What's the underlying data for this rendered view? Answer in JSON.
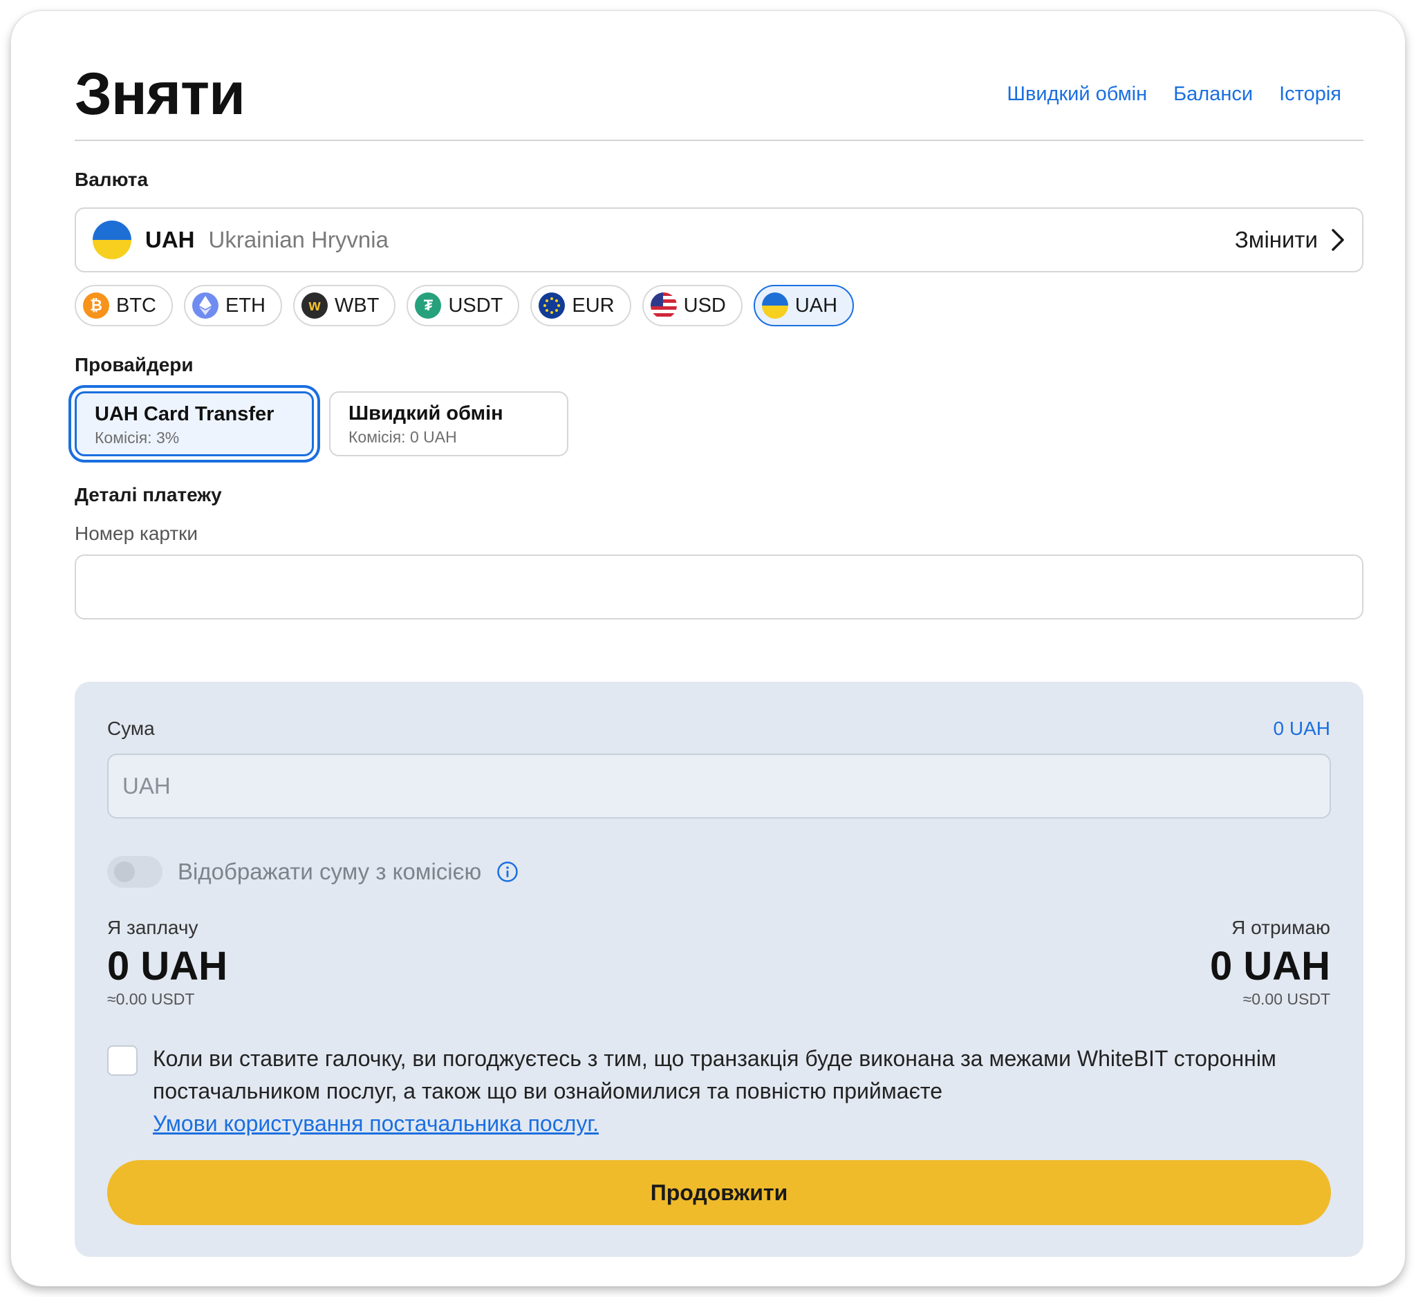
{
  "header": {
    "title": "Зняти",
    "links": [
      "Швидкий обмін",
      "Баланси",
      "Історія"
    ]
  },
  "currency": {
    "section_label": "Валюта",
    "selected_code": "UAH",
    "selected_name": "Ukrainian Hryvnia",
    "change_label": "Змінити",
    "chips": [
      {
        "code": "BTC",
        "icon": "bitcoin-icon"
      },
      {
        "code": "ETH",
        "icon": "ethereum-icon"
      },
      {
        "code": "WBT",
        "icon": "whitebit-token-icon"
      },
      {
        "code": "USDT",
        "icon": "tether-icon"
      },
      {
        "code": "EUR",
        "icon": "eu-flag-icon"
      },
      {
        "code": "USD",
        "icon": "us-flag-icon"
      },
      {
        "code": "UAH",
        "icon": "ukraine-flag-icon",
        "active": true
      }
    ]
  },
  "providers": {
    "section_label": "Провайдери",
    "items": [
      {
        "name": "UAH Card Transfer",
        "fee": "Комісія: 3%",
        "active": true
      },
      {
        "name": "Швидкий обмін",
        "fee": "Комісія: 0 UAH"
      }
    ]
  },
  "payment": {
    "section_label": "Деталі платежу",
    "card_label": "Номер картки",
    "card_value": ""
  },
  "amount": {
    "label": "Сума",
    "available": "0 UAH",
    "placeholder": "UAH",
    "toggle_label": "Відображати суму з комісією",
    "toggle_on": false,
    "pay_label": "Я заплачу",
    "pay_amount": "0 UAH",
    "pay_usdt": "≈0.00 USDT",
    "get_label": "Я отримаю",
    "get_amount": "0 UAH",
    "get_usdt": "≈0.00 USDT"
  },
  "agreement": {
    "checked": false,
    "text": "Коли ви ставите галочку, ви погоджуєтесь з тим, що транзакція буде виконана за межами WhiteBIT стороннім постачальником послуг, а також що ви ознайомилися та повністю приймаєте",
    "link": "Умови користування постачальника послуг."
  },
  "actions": {
    "continue_label": "Продовжити"
  },
  "colors": {
    "accent": "#1a6fe0",
    "button": "#f0bb2b",
    "panel": "#e2e8f1"
  }
}
